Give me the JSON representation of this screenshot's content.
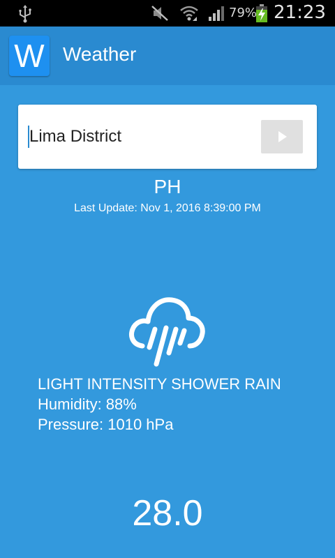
{
  "status_bar": {
    "battery_percent": "79%",
    "time": "21:23",
    "icons": [
      "usb-icon",
      "mute-icon",
      "wifi-icon",
      "signal-icon",
      "battery-charging-icon"
    ]
  },
  "app": {
    "logo_letter": "W",
    "title": "Weather"
  },
  "search": {
    "value": "Lima District",
    "go_icon": "play-icon"
  },
  "location": {
    "country": "PH",
    "last_update": "Last Update: Nov 1, 2016 8:39:00 PM"
  },
  "weather": {
    "icon": "rain-cloud-icon",
    "description": "LIGHT INTENSITY SHOWER RAIN",
    "humidity": "Humidity: 88%",
    "pressure": "Pressure: 1010 hPa",
    "temperature": "28.0"
  },
  "colors": {
    "background": "#3399dd",
    "action_bar": "#2a8ad0",
    "logo": "#1e90f0"
  }
}
